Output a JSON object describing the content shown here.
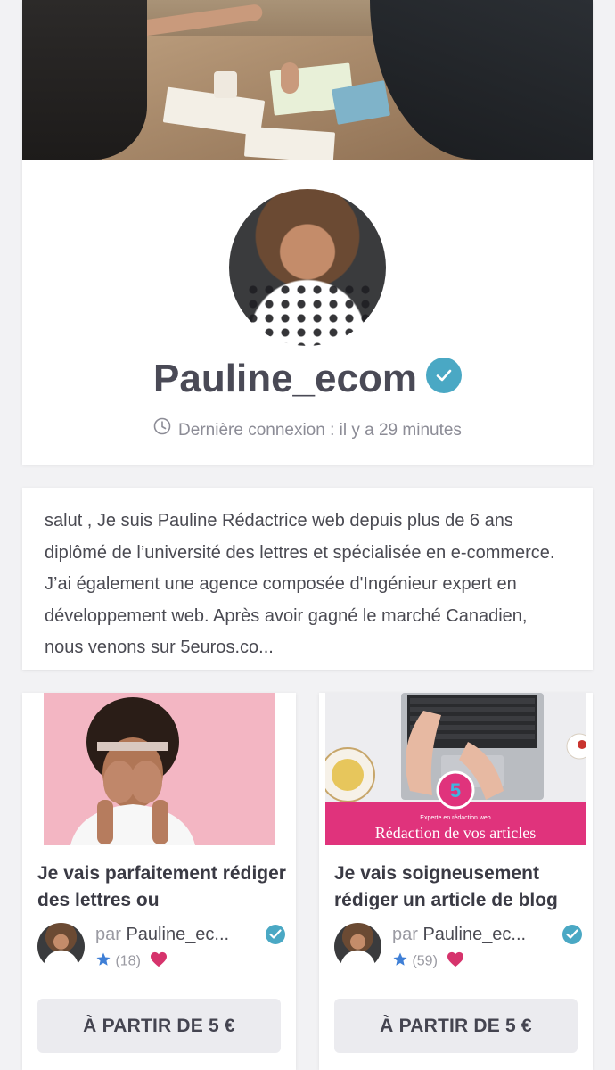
{
  "profile": {
    "username": "Pauline_ecom",
    "last_seen": "Dernière connexion : il y a 29 minutes",
    "verified": true
  },
  "bio": {
    "text": "salut , Je suis Pauline Rédactrice web depuis plus de 6 ans diplômé de l’université des lettres et spécialisée en e-commerce. J’ai également une agence composée d'Ingénieur expert en développement web. Après avoir gagné le marché Canadien, nous venons sur 5euros.co..."
  },
  "gigs": [
    {
      "title": "Je vais parfaitement rédiger des lettres ou",
      "seller_prefix": "par",
      "seller_name": "Pauline_ec...",
      "rating_count": "(18)",
      "price_label": "À PARTIR DE 5 €",
      "thumb_icon": "woman-hiding-face-photo"
    },
    {
      "title": "Je vais soigneusement rédiger un article de blog",
      "seller_prefix": "par",
      "seller_name": "Pauline_ec...",
      "rating_count": "(59)",
      "price_label": "À PARTIR DE 5 €",
      "thumb_icon": "laptop-typing-photo",
      "thumb_badge": "5",
      "thumb_subtitle": "Experte en rédaction web",
      "thumb_banner": "Rédaction de vos articles"
    }
  ],
  "colors": {
    "verified": "#4aa8c4",
    "star": "#3f7fd6",
    "heart": "#d6336c",
    "banner": "#e0337c"
  }
}
